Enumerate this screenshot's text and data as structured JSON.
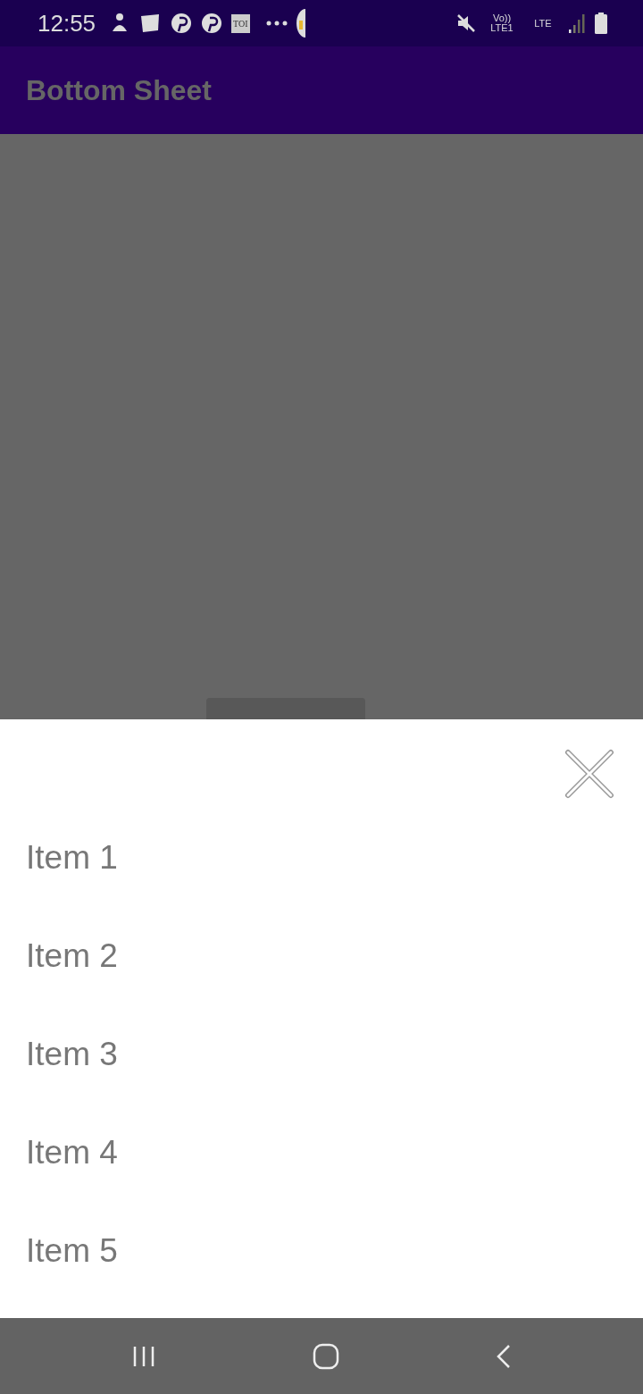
{
  "status_bar": {
    "time": "12:55",
    "notification_badge": "TOI",
    "network_label": "Vo)) LTE1",
    "data_label": "LTE"
  },
  "app_bar": {
    "title": "Bottom Sheet"
  },
  "bottom_sheet": {
    "items": [
      {
        "label": "Item 1"
      },
      {
        "label": "Item 2"
      },
      {
        "label": "Item 3"
      },
      {
        "label": "Item 4"
      },
      {
        "label": "Item 5"
      }
    ]
  }
}
